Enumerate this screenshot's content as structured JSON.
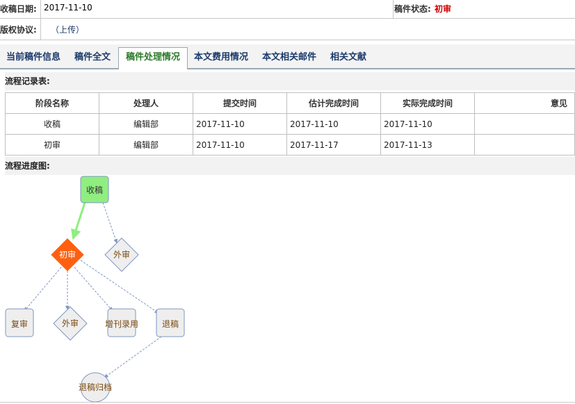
{
  "info": {
    "receive_date_label": "收稿日期:",
    "receive_date": "2017-11-10",
    "status_label": "稿件状态:",
    "status_value": "初审",
    "copyright_label": "版权协议:",
    "upload_link": "（上传）"
  },
  "tabs": [
    {
      "label": "当前稿件信息",
      "active": false
    },
    {
      "label": "稿件全文",
      "active": false
    },
    {
      "label": "稿件处理情况",
      "active": true
    },
    {
      "label": "本文费用情况",
      "active": false
    },
    {
      "label": "本文相关邮件",
      "active": false
    },
    {
      "label": "相关文献",
      "active": false
    }
  ],
  "flow_record": {
    "title": "流程记录表:",
    "headers": [
      "阶段名称",
      "处理人",
      "提交时间",
      "估计完成时间",
      "实际完成时间",
      "意见"
    ],
    "rows": [
      [
        "收稿",
        "编辑部",
        "2017-11-10",
        "2017-11-10",
        "2017-11-10",
        ""
      ],
      [
        "初审",
        "编辑部",
        "2017-11-10",
        "2017-11-17",
        "2017-11-13",
        ""
      ]
    ]
  },
  "flow_graph": {
    "title": "流程进度图:",
    "nodes": {
      "receive": "收稿",
      "first_review": "初审",
      "external_review_top": "外审",
      "re_review": "复审",
      "external_review": "外审",
      "supplement_accept": "增刊录用",
      "reject": "退稿",
      "reject_archive": "退稿归档"
    }
  },
  "colors": {
    "status_red": "#cc0000",
    "tab_text": "#1b3a6b",
    "tab_active_text": "#2a7a2a",
    "node_done": "#90ee80",
    "node_current": "#ff6010",
    "node_pending": "#eeeeee",
    "node_border": "#7f96c2",
    "edge_done": "#90ee80",
    "edge_pending": "#7f96c2"
  }
}
